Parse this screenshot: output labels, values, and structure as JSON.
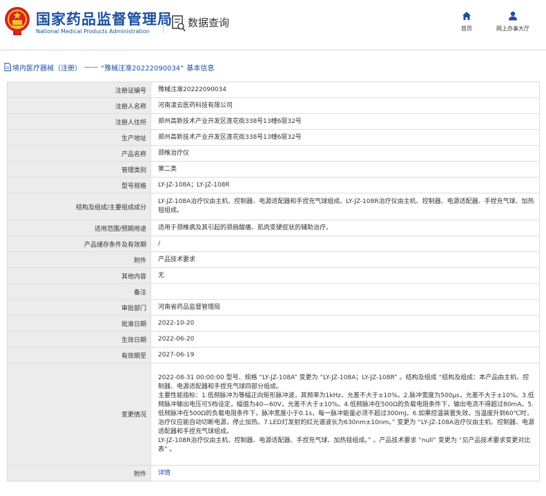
{
  "header": {
    "site_name_cn": "国家药品监督管理局",
    "site_name_en": "National Medical Products Administration",
    "section_title": "数据查询",
    "nav": [
      {
        "label": "首页",
        "icon": "home-icon"
      },
      {
        "label": "网上办事大厅",
        "icon": "user-icon"
      }
    ]
  },
  "breadcrumb": {
    "category": "境内医疗器械（注册）",
    "separator": "——",
    "record_id": "“豫械注准20222090034”",
    "suffix": "基本信息"
  },
  "colors": {
    "brand_blue": "#1a4fa0",
    "label_bg": "#ececec",
    "emblem_red": "#d6231e",
    "emblem_gold": "#f2c12e"
  },
  "record": {
    "rows": [
      {
        "label": "注册证编号",
        "value": "豫械注准20222090034"
      },
      {
        "label": "注册人名称",
        "value": "河南凌云医药科技有限公司"
      },
      {
        "label": "注册人住所",
        "value": "郑州高新技术产业开发区莲花街338号13幢6层32号"
      },
      {
        "label": "生产地址",
        "value": "郑州高新技术产业开发区莲花街338号13幢6层32号"
      },
      {
        "label": "产品名称",
        "value": "颈椎治疗仪"
      },
      {
        "label": "管理类别",
        "value": "第二类"
      },
      {
        "label": "型号规格",
        "value": "LY-JZ-108A；LY-JZ-108R"
      },
      {
        "label": "结构及组成/主要组成成分",
        "value": "LY-JZ-108A治疗仪由主机、控制器、电源适配器和手捏充气球组成。LY-JZ-108R治疗仪由主机、控制器、电源适配器、手捏充气球、加热毯组成。"
      },
      {
        "label": "适用范围/预期用途",
        "value": "适用于颈椎病及其引起的颈肩酸痛、肌肉变硬症状的辅助治疗。"
      },
      {
        "label": "产品储存条件及有效期",
        "value": "/"
      },
      {
        "label": "附件",
        "value": "产品技术要求"
      },
      {
        "label": "其他内容",
        "value": "无"
      },
      {
        "label": "备注",
        "value": ""
      },
      {
        "label": "审批部门",
        "value": "河南省药品监督管理局"
      },
      {
        "label": "批准日期",
        "value": "2022-10-20"
      },
      {
        "label": "生效日期",
        "value": "2022-06-20"
      },
      {
        "label": "有效期至",
        "value": "2027-06-19"
      },
      {
        "label": "变更情况",
        "value": "2022-08-31 00:00:00 型号、规格 “LY-JZ-108A” 变更为 “LY-JZ-108A；LY-JZ-108R” 。结构及组成 “结构及组成：本产品由主机、控制器、电源适配器和手捏充气球四部分组成。\n主要性能指标：1.低频脉冲为等幅正向矩形脉冲波，其频率为1kHz，允差不大于±10%。2.脉冲宽度为500μs，允差不大于±10%。3.低频脉冲输出电压可5档设定，幅值为40—60V，允差不大于±10%。4.低频脉冲在500Ω的负载电阻条件下，输出电流不得超过80mA。5.低频脉冲在500Ω的负载电阻条件下，脉冲宽度小于0.1s，每一脉冲能量必须不超过300mJ。6.如果控温装置失效，当温度升到60℃时，治疗仪应能自动切断电源，停止加热。7.LED灯发射的红光谱波长为630nm±10nm。” 变更为 “LY-JZ-108A治疗仪由主机、控制器、电源适配器和手捏充气球组成。\nLY-JZ-108R治疗仪由主机、控制器、电源适配器、手捏充气球、加热毯组成。” 。产品技术要求 “null” 变更为 “见产品技术要求变更对比表” 。"
      },
      {
        "label": "附件",
        "value": "详情"
      }
    ]
  }
}
